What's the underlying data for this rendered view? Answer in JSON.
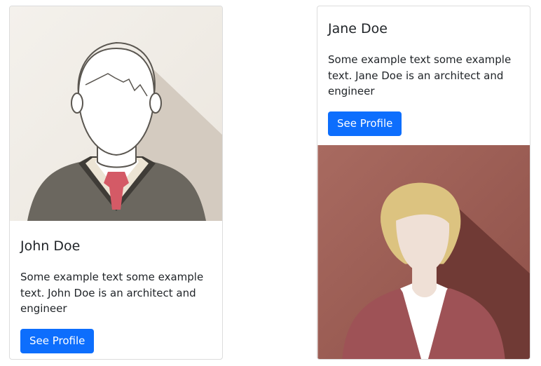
{
  "cards": [
    {
      "title": "John Doe",
      "text": "Some example text some example text. John Doe is an architect and engineer",
      "button_label": "See Profile"
    },
    {
      "title": "Jane Doe",
      "text": "Some example text some example text. Jane Doe is an architect and engineer",
      "button_label": "See Profile"
    }
  ],
  "colors": {
    "button": "#0d6efd",
    "male_bg": "#f1ede6",
    "female_bg": "#9a5a52"
  }
}
